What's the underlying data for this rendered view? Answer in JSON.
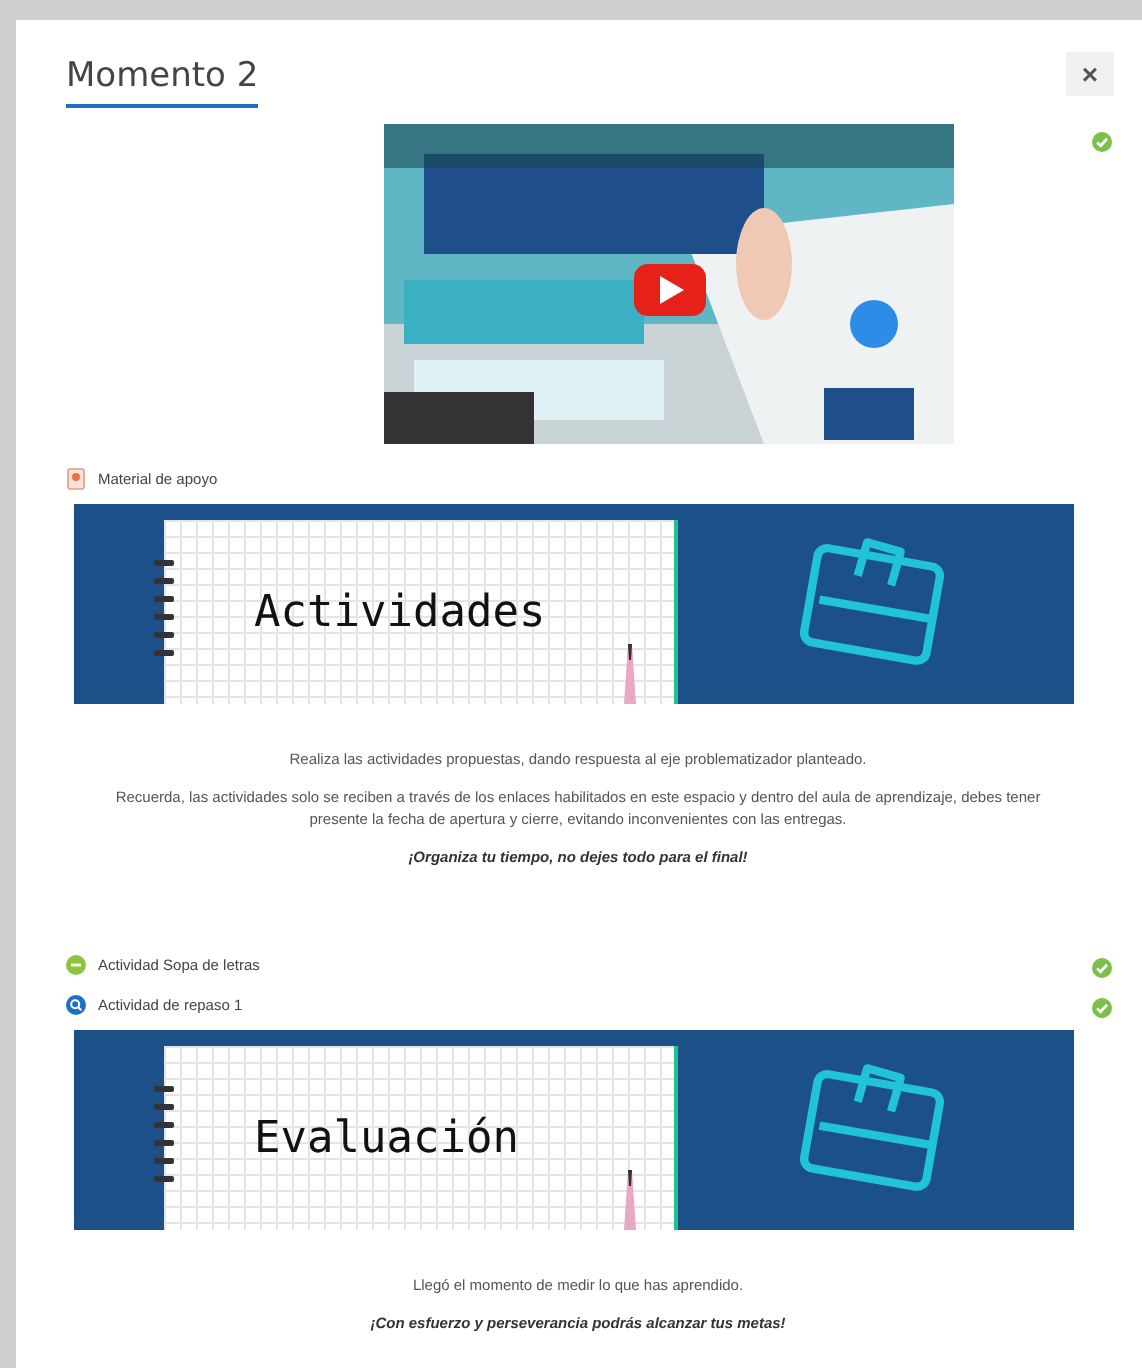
{
  "dialog": {
    "title": "Momento 2",
    "close": "×"
  },
  "sections": [
    {
      "kind": "video",
      "completed": true
    },
    {
      "kind": "resource",
      "label": "Material de apoyo"
    },
    {
      "kind": "banner",
      "caption": "Actividades"
    },
    {
      "kind": "text",
      "paragraphs": [
        {
          "text": "Realiza las actividades propuestas, dando respuesta al eje problematizador planteado.",
          "emphasis": false
        },
        {
          "text": "Recuerda, las actividades solo se reciben a través de los enlaces habilitados en este espacio y dentro del aula de aprendizaje, debes tener presente la fecha de apertura y cierre, evitando inconvenientes con las entregas.",
          "emphasis": false
        },
        {
          "text": "¡Organiza tu tiempo, no dejes todo para el final!",
          "emphasis": true
        }
      ]
    },
    {
      "kind": "puzzle",
      "label": "Actividad Sopa de letras",
      "completed": true
    },
    {
      "kind": "quiz",
      "label": "Actividad de repaso 1",
      "completed": true
    },
    {
      "kind": "banner",
      "caption": "Evaluación"
    },
    {
      "kind": "text",
      "paragraphs": [
        {
          "text": "Llegó el momento de medir lo que has aprendido.",
          "emphasis": false
        },
        {
          "text": "¡Con esfuerzo y perseverancia podrás alcanzar tus metas!",
          "emphasis": true
        }
      ]
    }
  ]
}
